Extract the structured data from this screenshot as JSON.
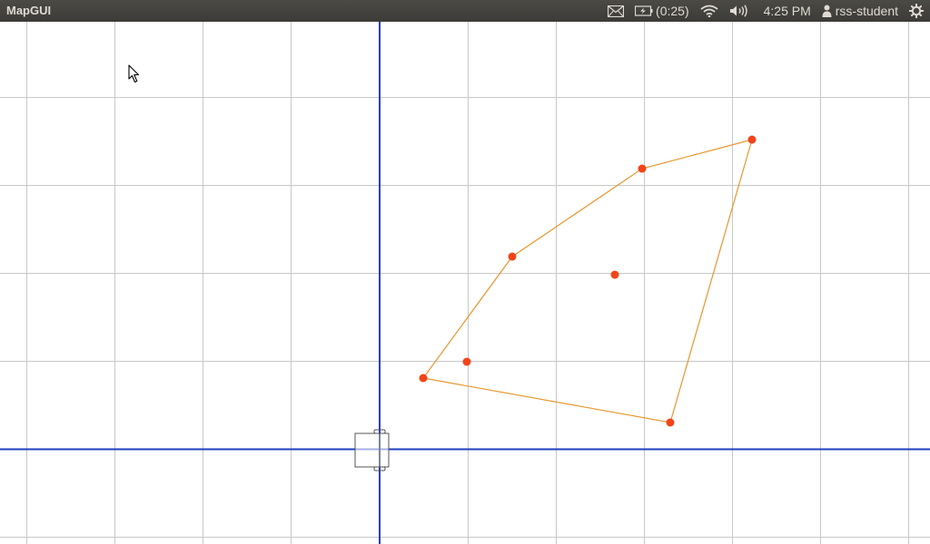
{
  "app": {
    "title": "MapGUI"
  },
  "topbar": {
    "mail_icon": "envelope-icon",
    "battery_icon": "battery-charging-icon",
    "battery_text": "(0:25)",
    "wifi_icon": "wifi-icon",
    "volume_icon": "speaker-icon",
    "clock": "4:25 PM",
    "user_icon": "person-icon",
    "username": "rss-student",
    "settings_icon": "gear-icon",
    "text_color": "#dfdbd2",
    "bar_color": "#3c3b37"
  },
  "map": {
    "grid_color": "#c8c8c8",
    "axis_color": "#1f3fbf",
    "polygon_color": "#e8962e",
    "point_color": "#f24418",
    "robot_icon": "robot-car-icon",
    "cursor_icon": "mouse-pointer-icon"
  }
}
